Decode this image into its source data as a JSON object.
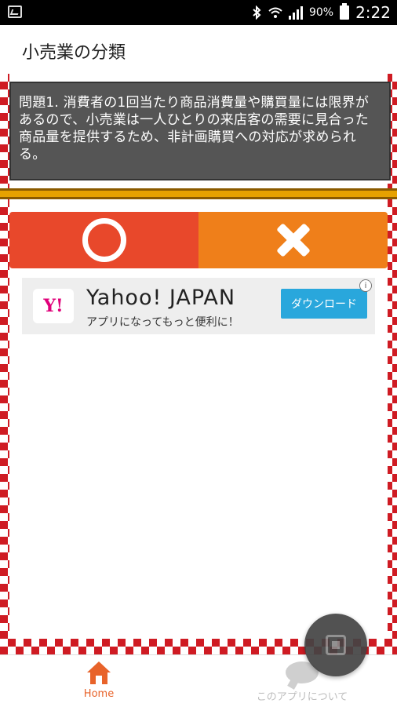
{
  "status_bar": {
    "battery_percent": "90%",
    "time": "2:22"
  },
  "app_bar": {
    "title": "小売業の分類"
  },
  "question": {
    "text": "問題1. 消費者の1回当たり商品消費量や購買量には限界があるので、小売業は一人ひとりの来店客の需要に見合った商品量を提供するため、非計画購買への対応が求められる。"
  },
  "answers": {
    "true_icon": "circle-icon",
    "false_icon": "cross-icon",
    "true_color": "#e8482b",
    "false_color": "#ef7f1a"
  },
  "ad": {
    "logo_text": "Y!",
    "title": "Yahoo! JAPAN",
    "subtitle": "アプリになってもっと便利に！",
    "button_label": "ダウンロード",
    "info_icon": "i"
  },
  "bottom_nav": {
    "home_label": "Home",
    "about_label": "このアプリについて",
    "active_color": "#e8632a"
  }
}
